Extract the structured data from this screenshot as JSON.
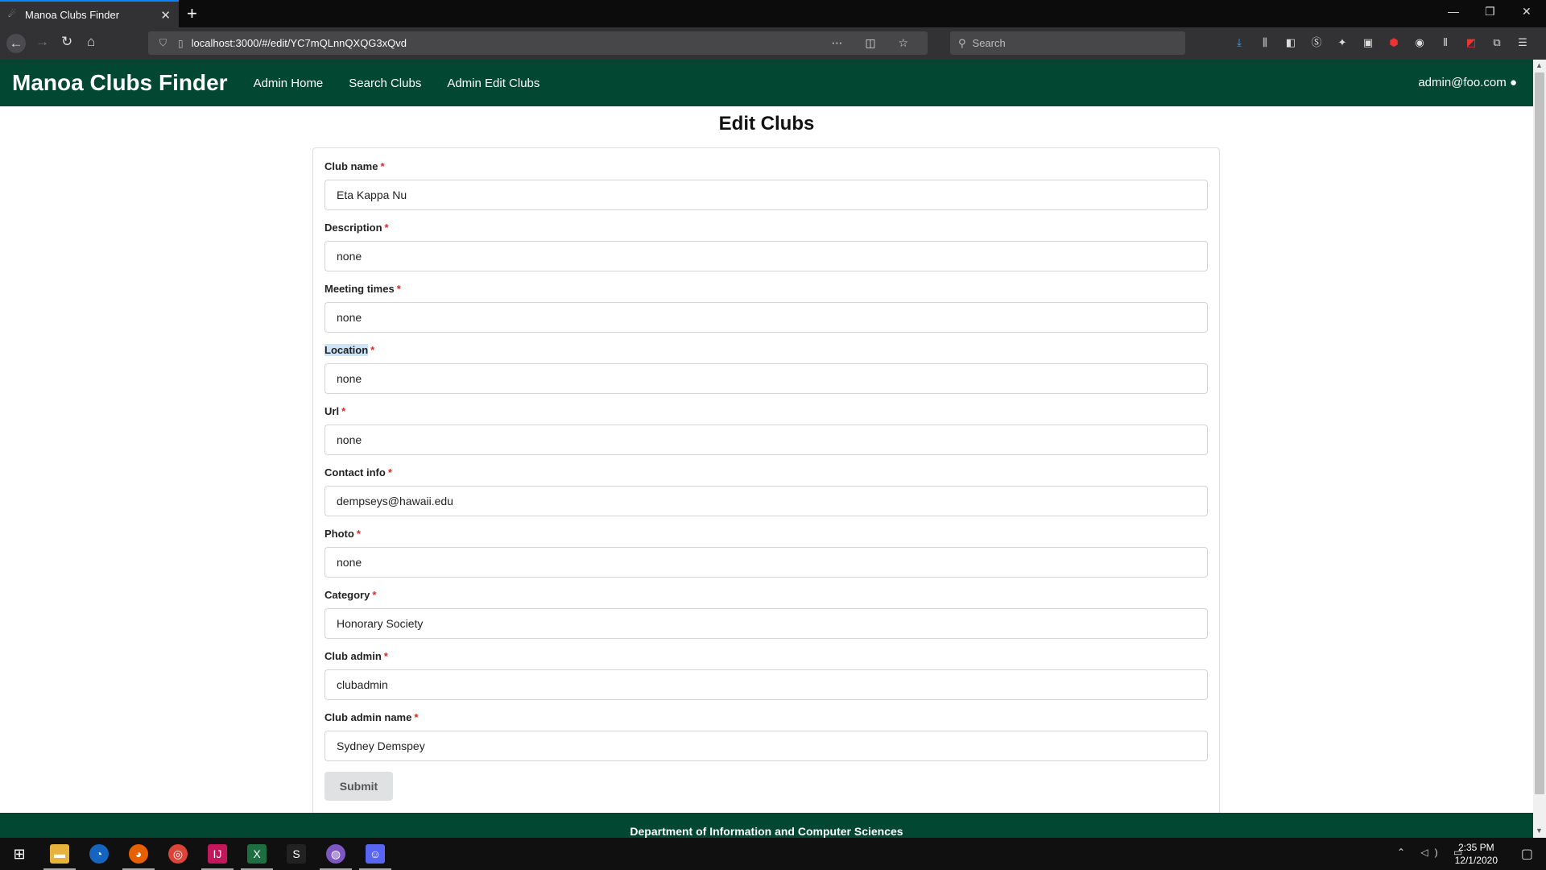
{
  "browser": {
    "tab_title": "Manoa Clubs Finder",
    "url": "localhost:3000/#/edit/YC7mQLnnQXQG3xQvd",
    "search_placeholder": "Search"
  },
  "app": {
    "brand": "Manoa Clubs Finder",
    "nav": [
      "Admin Home",
      "Search Clubs",
      "Admin Edit Clubs"
    ],
    "user": "admin@foo.com"
  },
  "page": {
    "title": "Edit Clubs",
    "submit_label": "Submit",
    "footer": "Department of Information and Computer Sciences"
  },
  "form": {
    "fields": [
      {
        "label": "Club name",
        "value": "Eta Kappa Nu"
      },
      {
        "label": "Description",
        "value": "none"
      },
      {
        "label": "Meeting times",
        "value": "none"
      },
      {
        "label": "Location",
        "value": "none"
      },
      {
        "label": "Url",
        "value": "none"
      },
      {
        "label": "Contact info",
        "value": "dempseys@hawaii.edu"
      },
      {
        "label": "Photo",
        "value": "none"
      },
      {
        "label": "Category",
        "value": "Honorary Society"
      },
      {
        "label": "Club admin",
        "value": "clubadmin"
      },
      {
        "label": "Club admin name",
        "value": "Sydney Demspey"
      }
    ],
    "required_mark": "*"
  },
  "taskbar": {
    "time": "2:35 PM",
    "date": "12/1/2020"
  },
  "colors": {
    "brand_green": "#024731",
    "required_red": "#db2828",
    "tab_accent": "#0a84ff"
  }
}
